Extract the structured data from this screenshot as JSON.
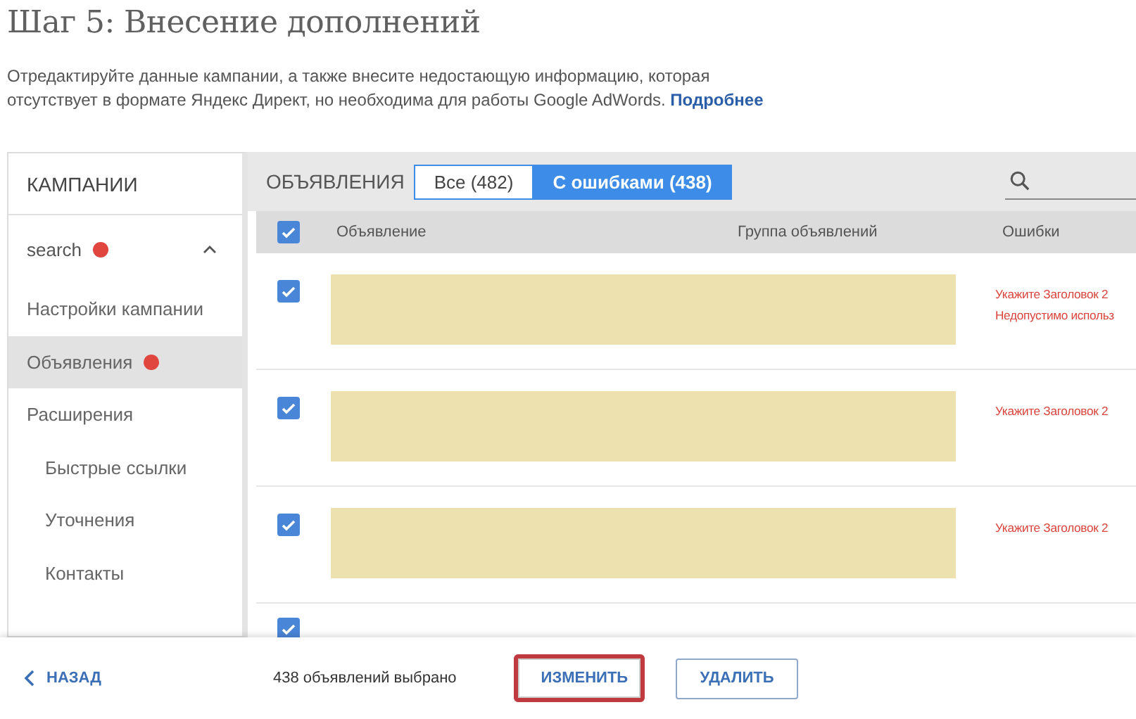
{
  "title": "Шаг 5: Внесение дополнений",
  "description": "Отредактируйте данные кампании, а также внесите недостающую информацию, которая отсутствует в формате Яндекс Директ, но необходима для работы Google AdWords.",
  "more_link": "Подробнее",
  "sidebar": {
    "heading": "КАМПАНИИ",
    "items": [
      {
        "label": "search",
        "kind": "campaign",
        "error": true,
        "expanded": true,
        "selected": false,
        "children": [
          {
            "label": "Настройки кампании",
            "error": false,
            "selected": false
          },
          {
            "label": "Объявления",
            "error": true,
            "selected": true
          },
          {
            "label": "Расширения",
            "error": false,
            "selected": false,
            "children": [
              {
                "label": "Быстрые ссылки",
                "error": false,
                "selected": false
              },
              {
                "label": "Уточнения",
                "error": false,
                "selected": false
              },
              {
                "label": "Контакты",
                "error": false,
                "selected": false
              }
            ]
          }
        ]
      }
    ]
  },
  "ads": {
    "heading": "ОБЪЯВЛЕНИЯ",
    "filters": [
      {
        "label": "Все (482)",
        "selected": false
      },
      {
        "label": "С ошибками (438)",
        "selected": true
      }
    ],
    "columns": [
      "Объявление",
      "Группа объявлений",
      "Ошибки"
    ],
    "select_all": {
      "checked": true
    },
    "rows": [
      {
        "checked": true,
        "errors": [
          "Укажите Заголовок 2",
          "Недопустимо использ"
        ]
      },
      {
        "checked": true,
        "errors": [
          "Укажите Заголовок 2"
        ]
      },
      {
        "checked": true,
        "errors": [
          "Укажите Заголовок 2"
        ]
      },
      {
        "checked": true
      }
    ]
  },
  "footer": {
    "back": "НАЗАД",
    "selected_count": "438 объявлений выбрано",
    "buttons": [
      {
        "label": "ИЗМЕНИТЬ",
        "highlighted": true
      },
      {
        "label": "УДАЛИТЬ",
        "highlighted": false
      }
    ]
  }
}
